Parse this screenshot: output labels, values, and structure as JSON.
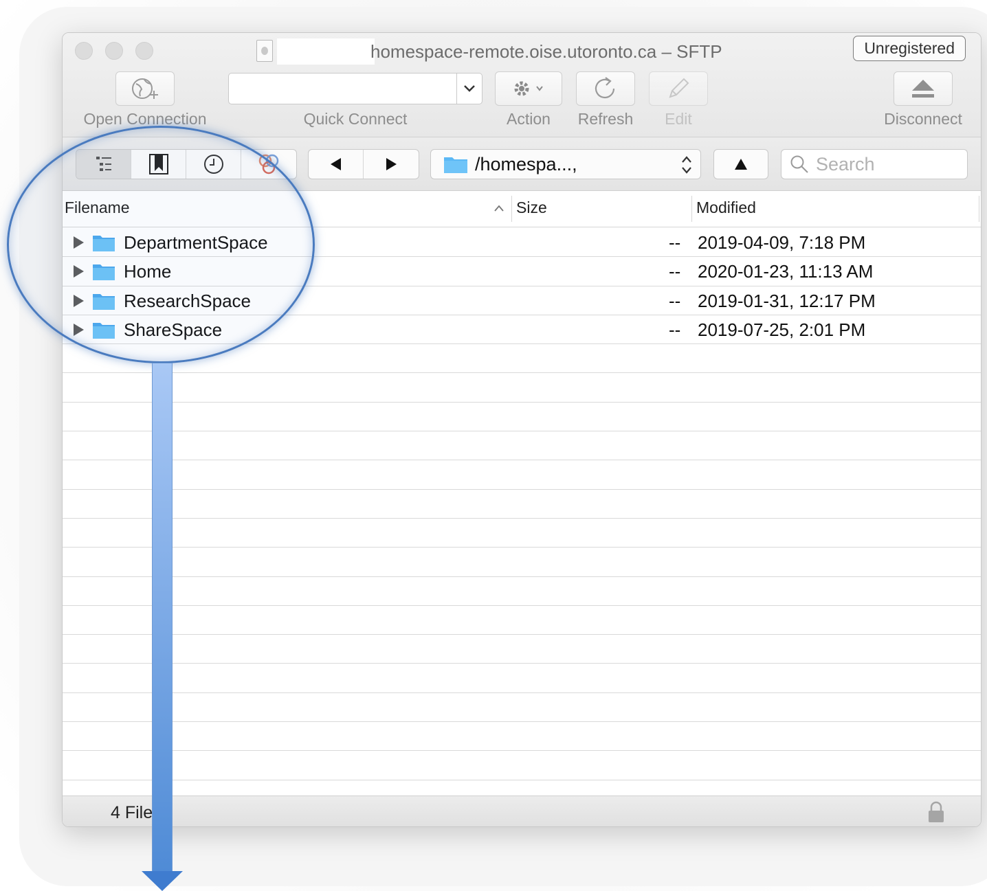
{
  "window": {
    "title": "homespace-remote.oise.utoronto.ca – SFTP",
    "registration_badge": "Unregistered"
  },
  "toolbar": {
    "open_connection": "Open Connection",
    "quick_connect": "Quick Connect",
    "action": "Action",
    "refresh": "Refresh",
    "edit": "Edit",
    "disconnect": "Disconnect"
  },
  "navbar": {
    "path": "/homespa...,",
    "search_placeholder": "Search"
  },
  "table": {
    "columns": [
      "Filename",
      "Size",
      "Modified"
    ],
    "rows": [
      {
        "name": "DepartmentSpace",
        "size": "--",
        "modified": "2019-04-09, 7:18 PM"
      },
      {
        "name": "Home",
        "size": "--",
        "modified": "2020-01-23, 11:13 AM"
      },
      {
        "name": "ResearchSpace",
        "size": "--",
        "modified": "2019-01-31, 12:17 PM"
      },
      {
        "name": "ShareSpace",
        "size": "--",
        "modified": "2019-07-25, 2:01 PM"
      }
    ]
  },
  "status": {
    "text": "4 File"
  },
  "colors": {
    "folder": "#5bb8f5",
    "annotation": "#4a7bbf"
  }
}
